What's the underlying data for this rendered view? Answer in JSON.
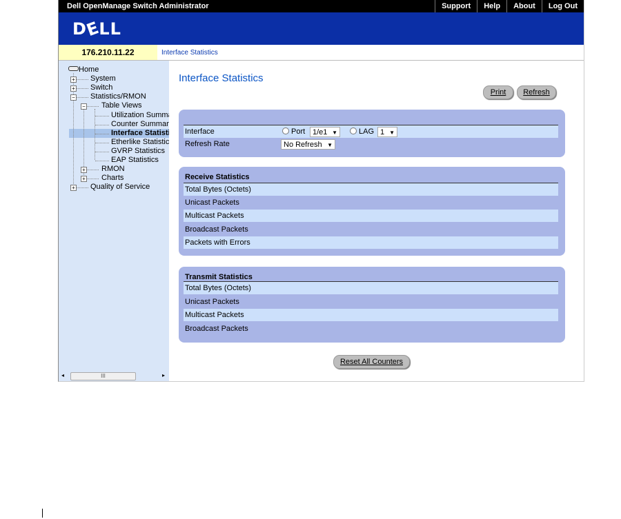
{
  "topbar": {
    "app_title": "Dell OpenManage Switch Administrator",
    "links": [
      "Support",
      "Help",
      "About",
      "Log Out"
    ]
  },
  "banner": {
    "logo_text": "D",
    "logo_e": "E",
    "logo_rest": "LL"
  },
  "address": {
    "ip": "176.210.11.22",
    "breadcrumb": "Interface Statistics"
  },
  "tree": {
    "home": "Home",
    "system": "System",
    "switch": "Switch",
    "statistics_rmon": "Statistics/RMON",
    "table_views": "Table Views",
    "utilization": "Utilization Summa",
    "counter": "Counter Summary",
    "interface_stats": "Interface Statisti",
    "etherlike": "Etherlike Statistic",
    "gvrp": "GVRP Statistics",
    "eap": "EAP Statistics",
    "rmon": "RMON",
    "charts": "Charts",
    "qos": "Quality of Service",
    "scroll_thumb": "III"
  },
  "main": {
    "title": "Interface Statistics",
    "print_label": "Print",
    "refresh_label": "Refresh",
    "interface_label": "Interface",
    "port_label": "Port",
    "port_value": "1/e1",
    "lag_label": "LAG",
    "lag_value": "1",
    "refresh_rate_label": "Refresh Rate",
    "refresh_rate_value": "No Refresh",
    "receive": {
      "header": "Receive Statistics",
      "rows": [
        "Total Bytes (Octets)",
        "Unicast Packets",
        "Multicast Packets",
        "Broadcast Packets",
        "Packets with Errors"
      ]
    },
    "transmit": {
      "header": "Transmit Statistics",
      "rows": [
        "Total Bytes (Octets)",
        "Unicast Packets",
        "Multicast Packets",
        "Broadcast Packets"
      ]
    },
    "reset_label": "Reset All Counters"
  },
  "colors": {
    "banner": "#0b2fa6",
    "sidebar": "#d9e6f8",
    "panel": "#a9b5e6",
    "row_light": "#cce0fb",
    "title": "#0b55c5"
  }
}
